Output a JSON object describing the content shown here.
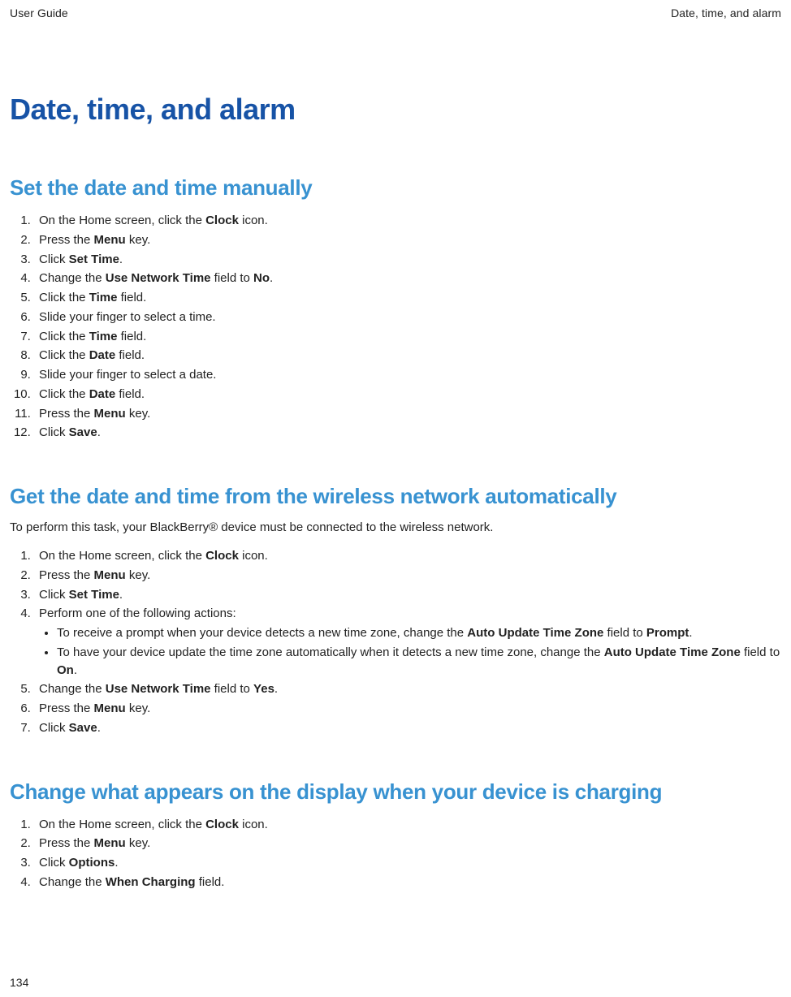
{
  "header": {
    "left": "User Guide",
    "right": "Date, time, and alarm"
  },
  "page_title": "Date, time, and alarm",
  "section1": {
    "heading": "Set the date and time manually",
    "steps": {
      "s1a": "On the Home screen, click the ",
      "s1b": "Clock",
      "s1c": " icon.",
      "s2a": "Press the ",
      "s2b": "Menu",
      "s2c": " key.",
      "s3a": "Click ",
      "s3b": "Set Time",
      "s3c": ".",
      "s4a": "Change the ",
      "s4b": "Use Network Time",
      "s4c": " field to ",
      "s4d": "No",
      "s4e": ".",
      "s5a": "Click the ",
      "s5b": "Time",
      "s5c": " field.",
      "s6": "Slide your finger to select a time.",
      "s7a": "Click the ",
      "s7b": "Time",
      "s7c": " field.",
      "s8a": "Click the ",
      "s8b": "Date",
      "s8c": " field.",
      "s9": "Slide your finger to select a date.",
      "s10a": "Click the ",
      "s10b": "Date",
      "s10c": " field.",
      "s11a": "Press the ",
      "s11b": "Menu",
      "s11c": " key.",
      "s12a": "Click ",
      "s12b": "Save",
      "s12c": "."
    }
  },
  "section2": {
    "heading": "Get the date and time from the wireless network automatically",
    "intro": "To perform this task, your BlackBerry® device must be connected to the wireless network.",
    "steps": {
      "s1a": "On the Home screen, click the ",
      "s1b": "Clock",
      "s1c": " icon.",
      "s2a": "Press the ",
      "s2b": "Menu",
      "s2c": " key.",
      "s3a": "Click ",
      "s3b": "Set Time",
      "s3c": ".",
      "s4": "Perform one of the following actions:",
      "b1a": "To receive a prompt when your device detects a new time zone, change the ",
      "b1b": "Auto Update Time Zone",
      "b1c": " field to ",
      "b1d": "Prompt",
      "b1e": ".",
      "b2a": "To have your device update the time zone automatically when it detects a new time zone, change the ",
      "b2b": "Auto Update Time Zone",
      "b2c": " field to ",
      "b2d": "On",
      "b2e": ".",
      "s5a": "Change the ",
      "s5b": "Use Network Time",
      "s5c": " field to ",
      "s5d": "Yes",
      "s5e": ".",
      "s6a": "Press the ",
      "s6b": "Menu",
      "s6c": " key.",
      "s7a": "Click ",
      "s7b": "Save",
      "s7c": "."
    }
  },
  "section3": {
    "heading": "Change what appears on the display when your device is charging",
    "steps": {
      "s1a": "On the Home screen, click the ",
      "s1b": "Clock",
      "s1c": " icon.",
      "s2a": "Press the ",
      "s2b": "Menu",
      "s2c": " key.",
      "s3a": "Click ",
      "s3b": "Options",
      "s3c": ".",
      "s4a": "Change the ",
      "s4b": "When Charging",
      "s4c": " field."
    }
  },
  "page_number": "134"
}
